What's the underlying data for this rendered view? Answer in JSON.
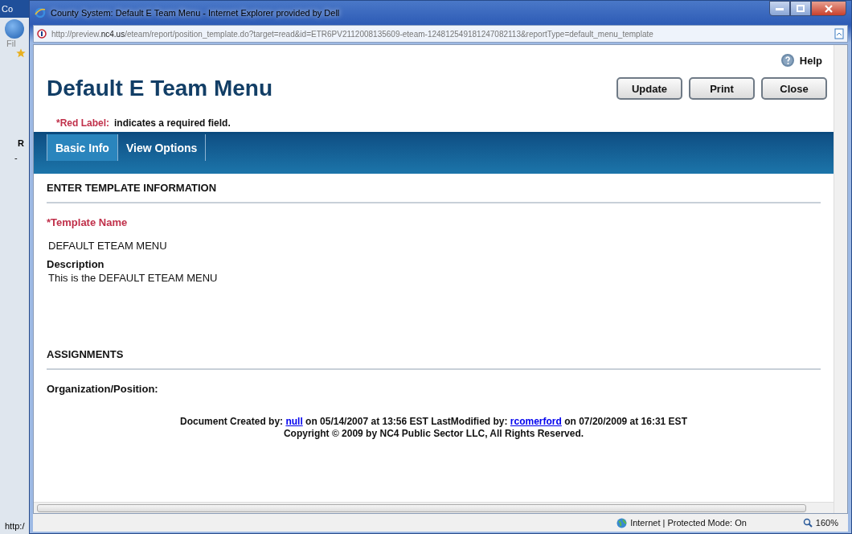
{
  "background_window": {
    "title": "Co",
    "menu_fragment": "Fil",
    "text_fragment": "R",
    "text_fragment_2": "-",
    "status_fragment": "http:/"
  },
  "window": {
    "title": "County System: Default E Team Menu - Internet Explorer provided by Dell",
    "url": "http://preview.**nc4.us**/eteam/report/position_template.do?target=read&id=ETR6PV2112008135609-eteam-124812549181247082113&reportType=default_menu_template"
  },
  "page": {
    "heading": "Default E Team Menu",
    "help": "Help",
    "buttons": [
      "Update",
      "Print",
      "Close"
    ],
    "required_note": {
      "label": "*Red Label:",
      "text": "indicates a required field."
    },
    "tabs": [
      {
        "label": "Basic Info",
        "selected": true
      },
      {
        "label": "View Options",
        "selected": false
      }
    ],
    "sections": [
      {
        "title": "ENTER TEMPLATE INFORMATION",
        "fields": [
          {
            "label": "*Template Name",
            "required": true,
            "value": "DEFAULT ETEAM MENU"
          },
          {
            "label": "Description",
            "required": false,
            "value": "This is the DEFAULT ETEAM MENU"
          }
        ]
      },
      {
        "title": "ASSIGNMENTS",
        "fields": [
          {
            "label": "Organization/Position:",
            "required": false
          }
        ]
      }
    ],
    "footer": {
      "created_prefix": "Document Created by:",
      "created_by": "null",
      "created_text": "on 05/14/2007 at 13:56 EST LastModified by:",
      "modified_by": "rcomerford",
      "modified_text": "on 07/20/2009 at 16:31 EST",
      "copyright": "Copyright © 2009 by NC4 Public Sector LLC, All Rights Reserved."
    }
  },
  "status_bar": {
    "zone": "Internet | Protected Mode: On",
    "zoom": "160%"
  }
}
